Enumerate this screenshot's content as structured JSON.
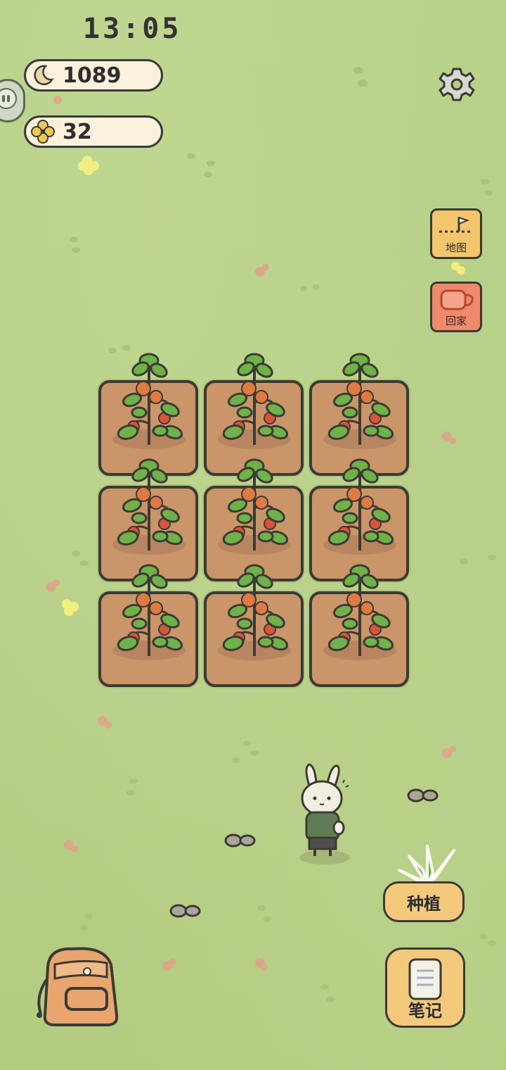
{
  "status_bar": {
    "time": "13:05"
  },
  "currency": {
    "moon": {
      "icon": "moon-icon",
      "value": "1089"
    },
    "clover": {
      "icon": "clover-icon",
      "value": "32"
    }
  },
  "side_buttons": {
    "map_label": "地图",
    "home_label": "回家"
  },
  "actions": {
    "plant_label": "种植",
    "notes_label": "笔记"
  },
  "farm": {
    "rows": 3,
    "cols": 3,
    "crop": "tomato-plant"
  },
  "colors": {
    "grass": "#b5cf86",
    "soil": "#c99569",
    "button_yellow": "#f5c97c",
    "home_red": "#f08a6a"
  }
}
